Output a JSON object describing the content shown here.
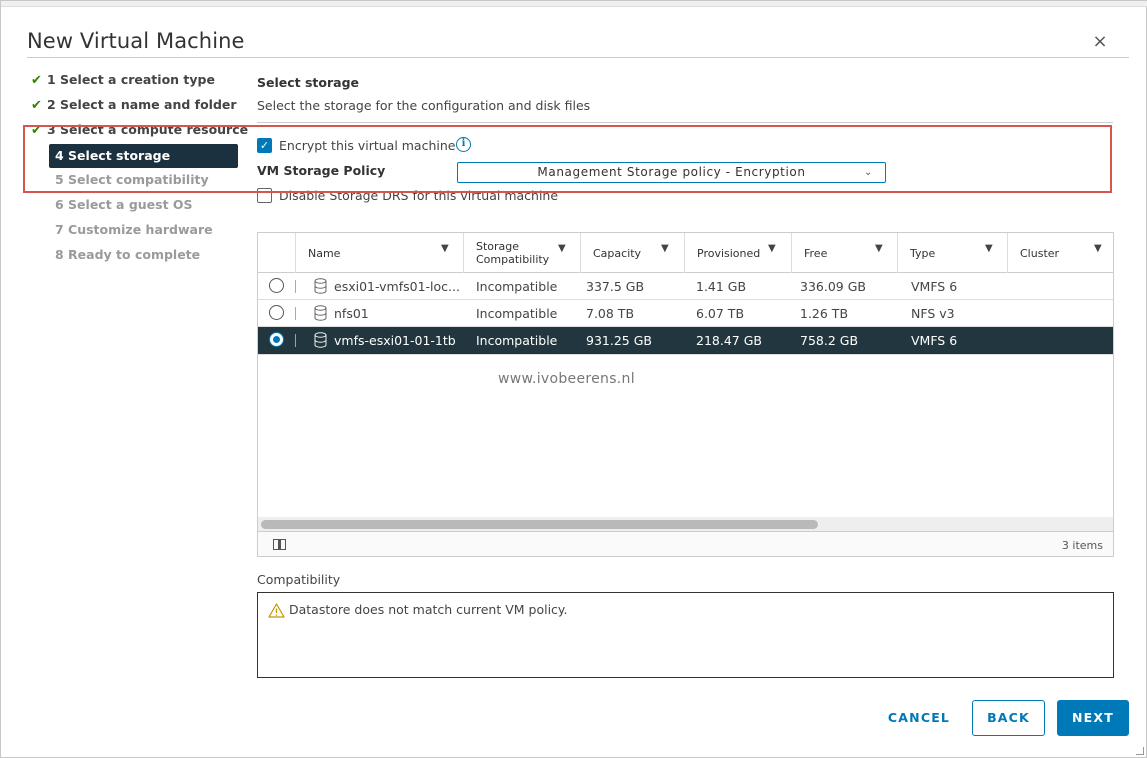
{
  "dialog": {
    "title": "New Virtual Machine",
    "close_glyph": "×"
  },
  "steps": [
    {
      "label": "1 Select a creation type",
      "state": "done"
    },
    {
      "label": "2 Select a name and folder",
      "state": "done"
    },
    {
      "label": "3 Select a compute resource",
      "state": "done"
    },
    {
      "label": "4 Select storage",
      "state": "current"
    },
    {
      "label": "5 Select compatibility",
      "state": "pending"
    },
    {
      "label": "6 Select a guest OS",
      "state": "pending"
    },
    {
      "label": "7 Customize hardware",
      "state": "pending"
    },
    {
      "label": "8 Ready to complete",
      "state": "pending"
    }
  ],
  "section": {
    "title": "Select storage",
    "subtitle": "Select the storage for the configuration and disk files"
  },
  "encrypt": {
    "label": "Encrypt this virtual machine",
    "checked": true
  },
  "policy": {
    "label": "VM Storage Policy",
    "value": "Management Storage policy - Encryption"
  },
  "storage_drs": {
    "label": "Disable Storage DRS for this virtual machine",
    "checked": false
  },
  "grid": {
    "columns": [
      "Name",
      "Storage Compatibility",
      "Capacity",
      "Provisioned",
      "Free",
      "Type",
      "Cluster"
    ],
    "rows": [
      {
        "name": "esxi01-vmfs01-loc...",
        "compat": "Incompatible",
        "capacity": "337.5 GB",
        "provisioned": "1.41 GB",
        "free": "336.09 GB",
        "type": "VMFS 6",
        "cluster": "",
        "selected": false
      },
      {
        "name": "nfs01",
        "compat": "Incompatible",
        "capacity": "7.08 TB",
        "provisioned": "6.07 TB",
        "free": "1.26 TB",
        "type": "NFS v3",
        "cluster": "",
        "selected": false
      },
      {
        "name": "vmfs-esxi01-01-1tb",
        "compat": "Incompatible",
        "capacity": "931.25 GB",
        "provisioned": "218.47 GB",
        "free": "758.2 GB",
        "type": "VMFS 6",
        "cluster": "",
        "selected": true
      }
    ],
    "item_count": "3 items"
  },
  "watermark": "www.ivobeerens.nl",
  "compatibility": {
    "label": "Compatibility",
    "message": "Datastore does not match current VM policy."
  },
  "buttons": {
    "cancel": "CANCEL",
    "back": "BACK",
    "next": "NEXT"
  },
  "colors": {
    "accent": "#0079b8",
    "selected_row": "#22363f",
    "highlight_box": "#d9534f",
    "done_check": "#2f8400"
  }
}
